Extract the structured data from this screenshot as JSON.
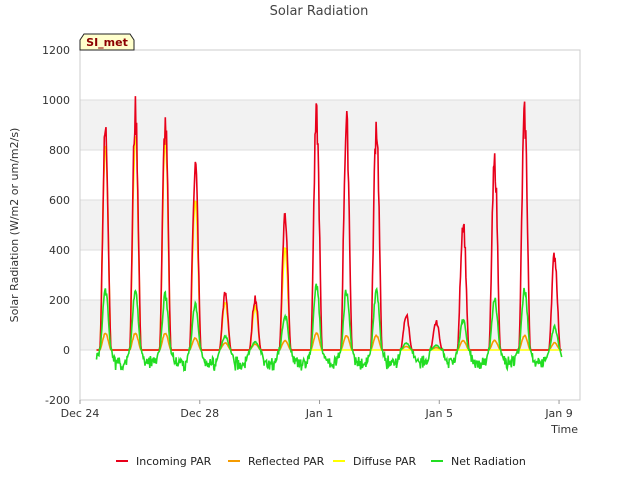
{
  "chart_data": {
    "type": "line",
    "title": "Solar Radiation",
    "xlabel": "Time",
    "ylabel": "Solar Radiation (W/m2 or um/m2/s)",
    "badge": "SI_met",
    "ylim": [
      -200,
      1200
    ],
    "yticks": [
      -200,
      0,
      200,
      400,
      600,
      800,
      1000,
      1200
    ],
    "xlim_days": [
      0,
      16.7
    ],
    "xticks": [
      {
        "day": 0,
        "label": "Dec 24"
      },
      {
        "day": 4,
        "label": "Dec 28"
      },
      {
        "day": 8,
        "label": "Jan 1"
      },
      {
        "day": 12,
        "label": "Jan 5"
      },
      {
        "day": 16,
        "label": "Jan 9"
      }
    ],
    "grid": true,
    "banded_background": true,
    "legend_position": "bottom",
    "series": [
      {
        "name": "Incoming PAR",
        "color": "#e8001a",
        "peaks": [
          945,
          1020,
          970,
          795,
          240,
          225,
          585,
          995,
          975,
          975,
          150,
          120,
          555,
          805,
          1000,
          410
        ]
      },
      {
        "name": "Reflected PAR",
        "color": "#f59b00",
        "peaks": [
          70,
          70,
          70,
          50,
          30,
          25,
          40,
          70,
          60,
          60,
          15,
          10,
          40,
          40,
          60,
          30
        ]
      },
      {
        "name": "Diffuse PAR",
        "color": "#ffff00",
        "peaks": [
          880,
          900,
          900,
          650,
          200,
          185,
          420,
          0,
          0,
          0,
          0,
          0,
          0,
          0,
          0,
          0
        ]
      },
      {
        "name": "Net Radiation",
        "color": "#22dd22",
        "peaks": [
          255,
          245,
          235,
          195,
          60,
          35,
          150,
          280,
          255,
          250,
          30,
          20,
          130,
          215,
          260,
          100
        ],
        "night_low": -85
      }
    ],
    "day_peak_positions": [
      0.85,
      1.85,
      2.85,
      3.85,
      4.85,
      5.85,
      6.85,
      7.9,
      8.9,
      9.9,
      10.9,
      11.9,
      12.8,
      13.85,
      14.85,
      15.85
    ]
  }
}
